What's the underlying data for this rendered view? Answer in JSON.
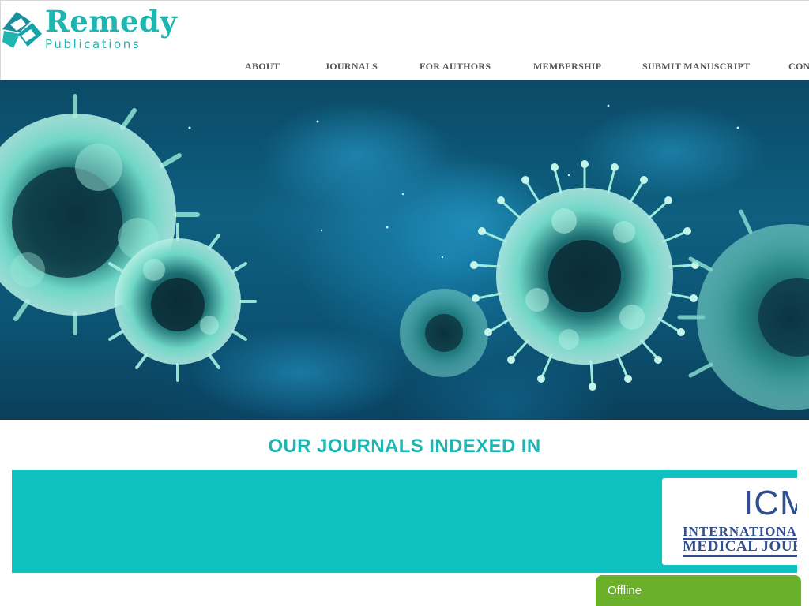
{
  "brand": {
    "name": "Remedy",
    "tagline": "Publications",
    "color": "#1fb5b0"
  },
  "nav": {
    "items": [
      {
        "label": "ABOUT"
      },
      {
        "label": "JOURNALS"
      },
      {
        "label": "FOR AUTHORS"
      },
      {
        "label": "MEMBERSHIP"
      },
      {
        "label": "SUBMIT MANUSCRIPT"
      },
      {
        "label": "CON"
      }
    ]
  },
  "hero": {
    "image": "virus-particles-image"
  },
  "indexed": {
    "title": "OUR JOURNALS INDEXED IN",
    "band_color": "#10c1c1",
    "logos": [
      {
        "name": "icmje-logo",
        "mark": "ICMJ",
        "line1": "INTERNATIONAL C",
        "line2": "MEDICAL JOURN"
      }
    ]
  },
  "chat": {
    "status": "Offline",
    "color": "#6bb02a"
  }
}
